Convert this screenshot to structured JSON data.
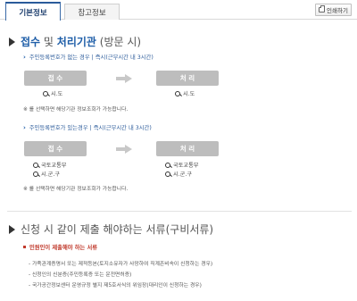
{
  "tabs": [
    {
      "label": "기본정보"
    },
    {
      "label": "참고정보"
    }
  ],
  "print_label": "인쇄하기",
  "section1": {
    "title_part1": "접수",
    "title_part2": "및",
    "title_part3": "처리기관",
    "title_part4": "(방문 시)",
    "group1": {
      "head": "주민등록번호가 없는 경우 | 즉시(근무시간 내 3시간)",
      "step1": "접 수",
      "step2": "처 리",
      "lookup1": "시.도",
      "lookup2": "시.도",
      "note": "※ 를 선택하면 해당기관 정보조회가 가능합니다."
    },
    "group2": {
      "head": "주민등록번호가 있는경우 | 즉시(근무시간 내 3시간)",
      "step1": "접 수",
      "step2": "처 리",
      "lookup1a": "국토교통부",
      "lookup1b": "시.군.구",
      "lookup2a": "국토교통부",
      "lookup2b": "시.군.구",
      "note": "※ 를 선택하면 해당기관 정보조회가 가능합니다."
    }
  },
  "section2": {
    "title": "신청 시 같이 제출 해야하는 서류(구비서류)",
    "sub": "민원인이 제출해야 하는 서류",
    "items": [
      "가족관계증명서 또는 제적등본(토지소유자가 사망하여 직계존비속이 신청하는 경우)",
      "신청인의 신분증(주민등록증 또는 운전면허증)",
      "국가공간정보센터 운영규정 별지 제5호서식의 위임장(대리인이 신청하는 경우)"
    ]
  }
}
